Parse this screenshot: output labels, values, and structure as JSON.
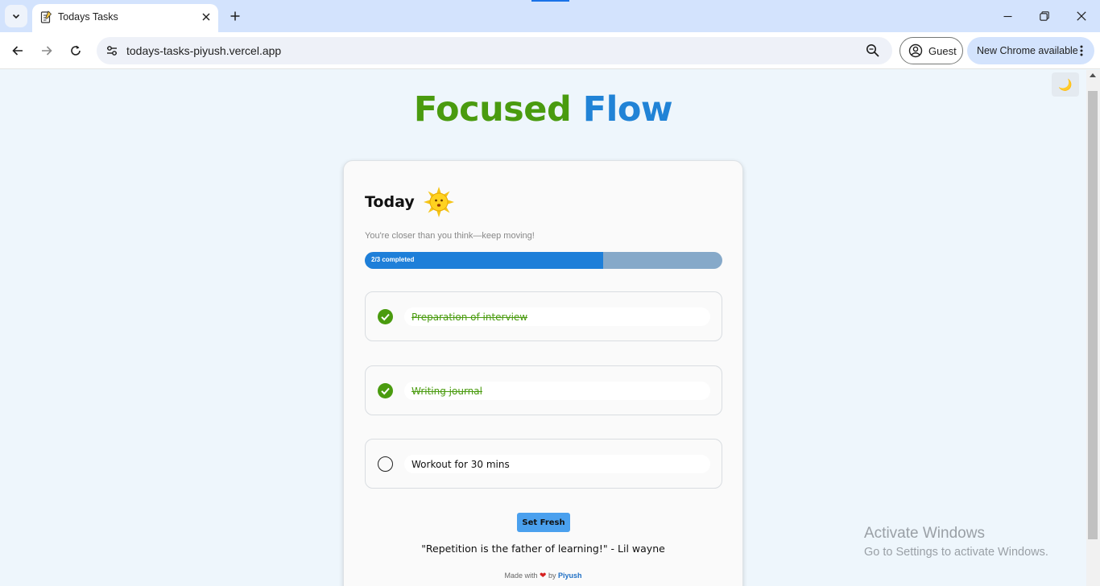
{
  "browser": {
    "tab_title": "Todays Tasks",
    "url": "todays-tasks-piyush.vercel.app",
    "profile_label": "Guest",
    "update_label": "New Chrome available"
  },
  "page": {
    "theme_toggle_icon": "🌙",
    "app_title_word1": "Focused",
    "app_title_word2": "Flow",
    "heading": "Today",
    "tagline": "You're closer than you think—keep moving!",
    "progress": {
      "label": "2/3 completed",
      "completed": 2,
      "total": 3
    },
    "tasks": [
      {
        "text": "Preparation of interview",
        "done": true
      },
      {
        "text": "Writing journal",
        "done": true
      },
      {
        "text": "Workout for 30 mins",
        "done": false
      }
    ],
    "reset_button": "Set Fresh",
    "quote": "\"Repetition is the father of learning!\" - Lil wayne",
    "footer": {
      "prefix": "Made with",
      "by": "by",
      "author": "Piyush"
    }
  },
  "watermark": {
    "title": "Activate Windows",
    "subtitle": "Go to Settings to activate Windows."
  },
  "colors": {
    "title_green": "#4a9b0f",
    "title_blue": "#2183d6",
    "progress_fill": "#1e7fd9",
    "done_green": "#4a9b0f",
    "button_blue": "#4aa0ee"
  }
}
